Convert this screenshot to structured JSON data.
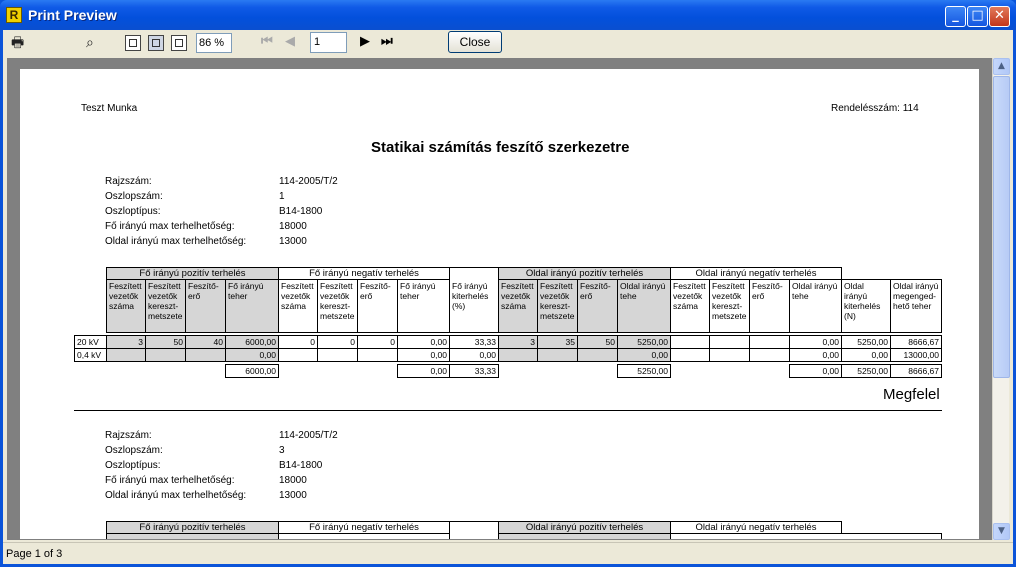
{
  "window": {
    "title": "Print Preview",
    "app_icon_letter": "R",
    "min": "_",
    "max": "□",
    "close": "✕"
  },
  "toolbar": {
    "zoom": "86 %",
    "page_value": "1",
    "close_label": "Close"
  },
  "status": {
    "text": "Page 1 of 3"
  },
  "page": {
    "header_left": "Teszt Munka",
    "header_right": "Rendelésszám: 114",
    "title": "Statikai számítás feszítő szerkezetre",
    "verdict": "Megfelel"
  },
  "blocks": [
    {
      "labels": [
        "Rajzszám:",
        "Oszlopszám:",
        "Oszloptípus:",
        "Fő irányú max terhelhetőség:",
        "Oldal irányú max terhelhetőség:"
      ],
      "values": [
        "114-2005/T/2",
        "1",
        "B14-1800",
        "18000",
        "13000"
      ]
    },
    {
      "labels": [
        "Rajzszám:",
        "Oszlopszám:",
        "Oszloptípus:",
        "Fő irányú max terhelhetőség:",
        "Oldal irányú max terhelhetőség:"
      ],
      "values": [
        "114-2005/T/2",
        "3",
        "B14-1800",
        "18000",
        "13000"
      ]
    }
  ],
  "table": {
    "groups": [
      "Fő irányú pozitív terhelés",
      "Fő irányú negatív terhelés",
      "Oldal irányú pozitív terhelés",
      "Oldal irányú negatív terhelés"
    ],
    "headers": [
      "Feszített vezetők száma",
      "Feszített vezetők kereszt-metszete",
      "Feszítő-erő",
      "Fő irányú teher",
      "Feszített vezetők száma",
      "Feszített vezetők kereszt-metszete",
      "Feszítő-erő",
      "Fő irányú teher",
      "Fő irányú kiterhelés (%)",
      "Feszített vezetők száma",
      "Feszített vezetők kereszt-metszete",
      "Feszítő-erő",
      "Oldal irányú tehe",
      "Feszített vezetők száma",
      "Feszített vezetők kereszt-metszete",
      "Feszítő-erő",
      "Oldal irányú tehe",
      "Oldal irányú kiterhelés (N)",
      "Oldal irányú megenged-hető teher"
    ],
    "rows": [
      [
        "20 kV",
        "3",
        "50",
        "40",
        "6000,00",
        "0",
        "0",
        "0",
        "0,00",
        "33,33",
        "3",
        "35",
        "50",
        "5250,00",
        "",
        "",
        "",
        "0,00",
        "5250,00",
        "8666,67"
      ],
      [
        "0,4 kV",
        "",
        "",
        "",
        "0,00",
        "",
        "",
        "",
        "0,00",
        "0,00",
        "",
        "",
        "",
        "0,00",
        "",
        "",
        "",
        "0,00",
        "0,00",
        "13000,00"
      ]
    ],
    "totals": [
      "6000,00",
      "0,00",
      "33,33",
      "5250,00",
      "0,00",
      "5250,00",
      "8666,67"
    ]
  }
}
